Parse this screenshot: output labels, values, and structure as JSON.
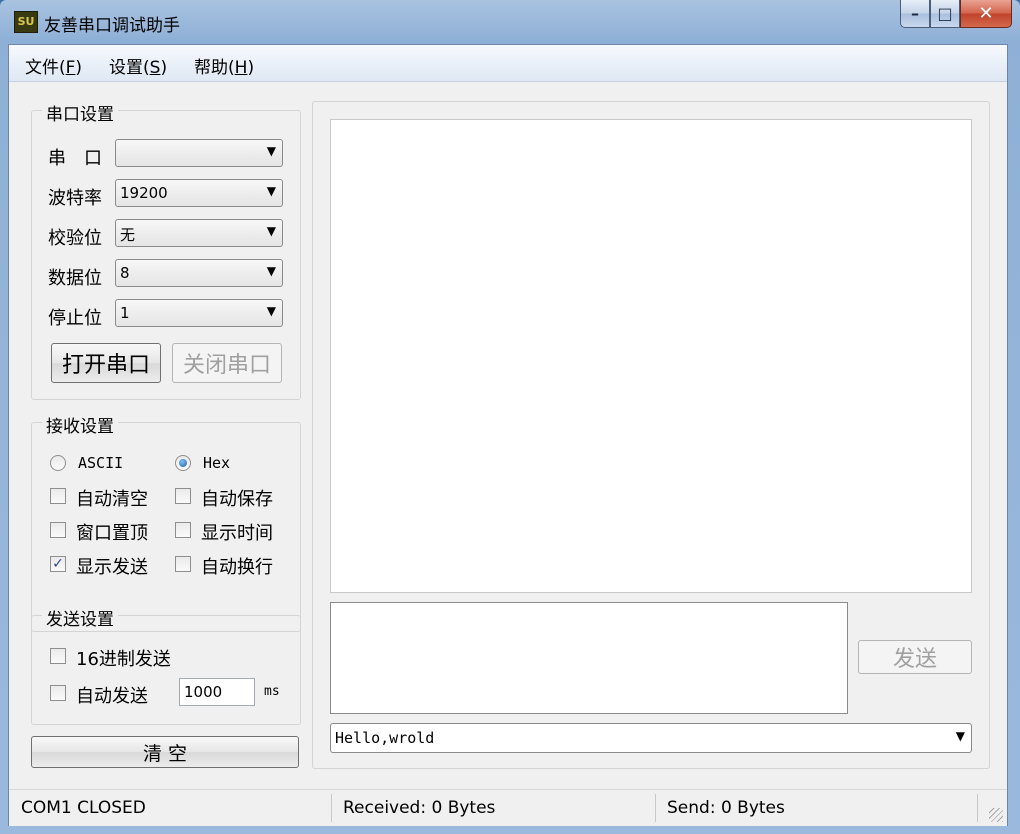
{
  "window": {
    "title": "友善串口调试助手",
    "icon_text": "SU"
  },
  "menu": [
    {
      "text": "文件(",
      "key": "F",
      "end": ")"
    },
    {
      "text": "设置(",
      "key": "S",
      "end": ")"
    },
    {
      "text": "帮助(",
      "key": "H",
      "end": ")"
    }
  ],
  "serial": {
    "title": "串口设置",
    "port_label": "串　口",
    "port_value": "",
    "baud_label": "波特率",
    "baud_value": "19200",
    "parity_label": "校验位",
    "parity_value": "无",
    "databits_label": "数据位",
    "databits_value": "8",
    "stopbits_label": "停止位",
    "stopbits_value": "1",
    "open_button": "打开串口",
    "close_button": "关闭串口"
  },
  "receive": {
    "title": "接收设置",
    "ascii_label": "ASCII",
    "hex_label": "Hex",
    "mode_selected": "Hex",
    "auto_clear": {
      "label": "自动清空",
      "checked": false
    },
    "auto_save": {
      "label": "自动保存",
      "checked": false
    },
    "window_top": {
      "label": "窗口置顶",
      "checked": false
    },
    "show_time": {
      "label": "显示时间",
      "checked": false
    },
    "show_send": {
      "label": "显示发送",
      "checked": true
    },
    "auto_newline": {
      "label": "自动换行",
      "checked": false
    }
  },
  "send": {
    "title": "发送设置",
    "hex_send": {
      "label": "16进制发送",
      "checked": false
    },
    "auto_send": {
      "label": "自动发送",
      "checked": false
    },
    "interval_value": "1000",
    "interval_unit": "ms",
    "send_button": "发送",
    "history_value": "Hello,wrold"
  },
  "clear_button": "清  空",
  "status": {
    "port": "COM1 CLOSED",
    "received": "Received: 0 Bytes",
    "sent": "Send: 0 Bytes"
  },
  "icons": {
    "minimize": "–",
    "maximize": "□",
    "close": "✕",
    "dropdown": "▼",
    "check": "✓"
  }
}
